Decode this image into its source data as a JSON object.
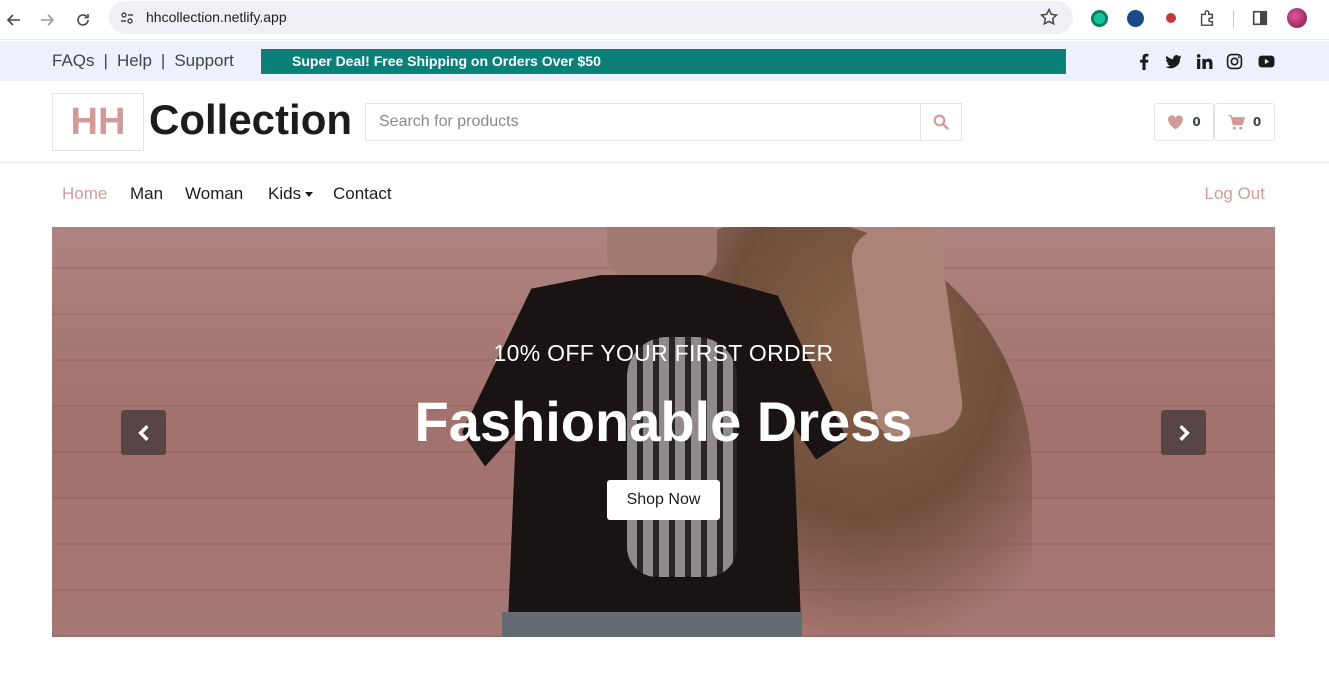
{
  "browser": {
    "url": "hhcollection.netlify.app"
  },
  "topbar": {
    "links": [
      "FAQs",
      "Help",
      "Support"
    ],
    "separator": "|",
    "promo": "Super Deal! Free Shipping on Orders Over $50"
  },
  "header": {
    "logo_mark": "HH",
    "logo_text": "Collection",
    "search_placeholder": "Search for products",
    "wishlist_count": "0",
    "cart_count": "0"
  },
  "nav": {
    "items": [
      "Home",
      "Man",
      "Woman",
      "Kids",
      "Contact"
    ],
    "active": "Home",
    "logout": "Log Out"
  },
  "hero": {
    "subtitle": "10% OFF YOUR FIRST ORDER",
    "title": "Fashionable Dress",
    "cta": "Shop Now"
  },
  "colors": {
    "accent": "#d19c97",
    "promo_bg": "#0b8079",
    "topbar_bg": "#eef0fb"
  }
}
